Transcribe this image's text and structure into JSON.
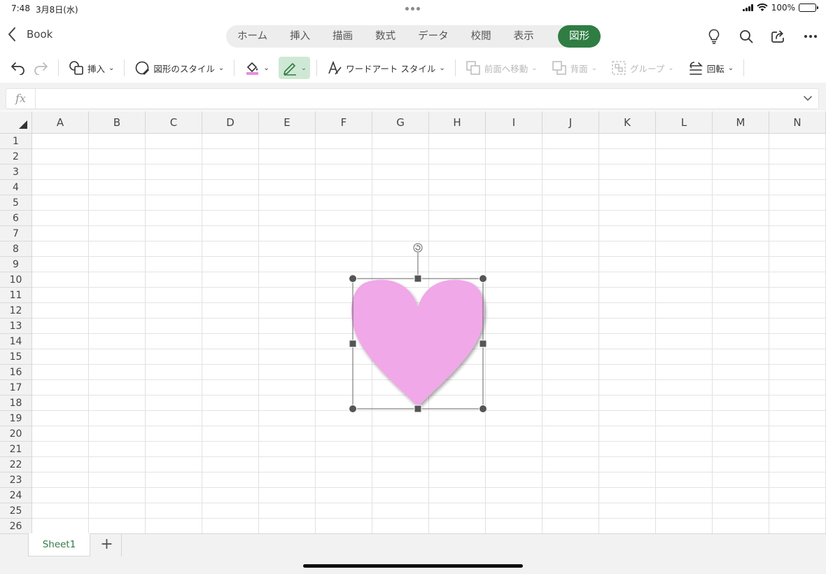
{
  "status": {
    "time": "7:48",
    "date": "3月8日(水)",
    "battery": "100%"
  },
  "header": {
    "back_title": "Book",
    "tabs": [
      {
        "label": "ホーム"
      },
      {
        "label": "挿入"
      },
      {
        "label": "描画"
      },
      {
        "label": "数式"
      },
      {
        "label": "データ"
      },
      {
        "label": "校閲"
      },
      {
        "label": "表示"
      },
      {
        "label": "図形",
        "active": true
      }
    ]
  },
  "toolbar": {
    "insert": "挿入",
    "shape_styles": "図形のスタイル",
    "wordart_styles": "ワードアート スタイル",
    "bring_forward": "前面へ移動",
    "send_backward": "背面",
    "group": "グループ",
    "rotate": "回転"
  },
  "formula_bar": {
    "fx": "fx",
    "value": ""
  },
  "grid": {
    "columns": [
      "A",
      "B",
      "C",
      "D",
      "E",
      "F",
      "G",
      "H",
      "I",
      "J",
      "K",
      "L",
      "M",
      "N"
    ],
    "rows": [
      "1",
      "2",
      "3",
      "4",
      "5",
      "6",
      "7",
      "8",
      "9",
      "10",
      "11",
      "12",
      "13",
      "14",
      "15",
      "16",
      "17",
      "18",
      "19",
      "20",
      "21",
      "22",
      "23",
      "24",
      "25",
      "26"
    ]
  },
  "shape": {
    "type": "heart",
    "fill_color": "#f0a8e8"
  },
  "colors": {
    "accent": "#2f7d43",
    "selected_tool_bg": "#cfe8d5"
  },
  "sheets": {
    "tabs": [
      "Sheet1"
    ],
    "add_label": "+"
  }
}
